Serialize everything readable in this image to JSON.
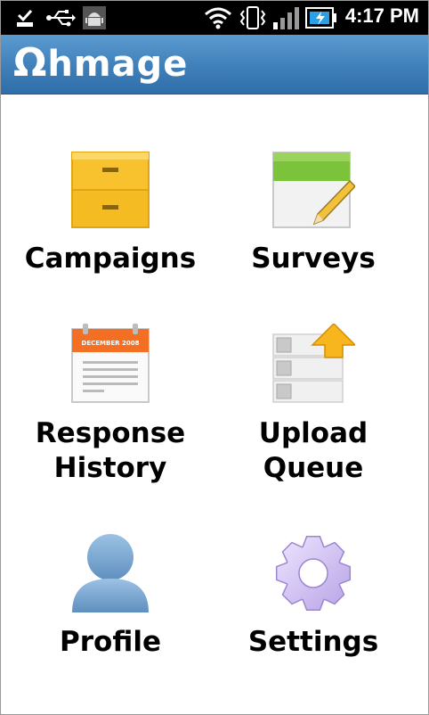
{
  "status_bar": {
    "time": "4:17 PM",
    "icons": [
      "download-done-icon",
      "usb-icon",
      "android-debug-icon",
      "wifi-icon",
      "vibrate-icon",
      "signal-icon",
      "battery-charging-icon"
    ]
  },
  "app_bar": {
    "logo_symbol": "Ω",
    "logo_text": "hmage"
  },
  "menu": [
    {
      "label": "Campaigns",
      "icon": "folder-cabinet-icon"
    },
    {
      "label": "Surveys",
      "icon": "survey-pencil-icon"
    },
    {
      "label": "Response History",
      "line1": "Response",
      "line2": "History",
      "icon": "calendar-icon",
      "calendar_header": "DECEMBER 2008"
    },
    {
      "label": "Upload Queue",
      "line1": "Upload",
      "line2": "Queue",
      "icon": "upload-queue-icon"
    },
    {
      "label": "Profile",
      "icon": "person-icon"
    },
    {
      "label": "Settings",
      "icon": "gear-icon"
    }
  ],
  "colors": {
    "app_bar": "#3f7fba",
    "status_bar": "#000000"
  }
}
